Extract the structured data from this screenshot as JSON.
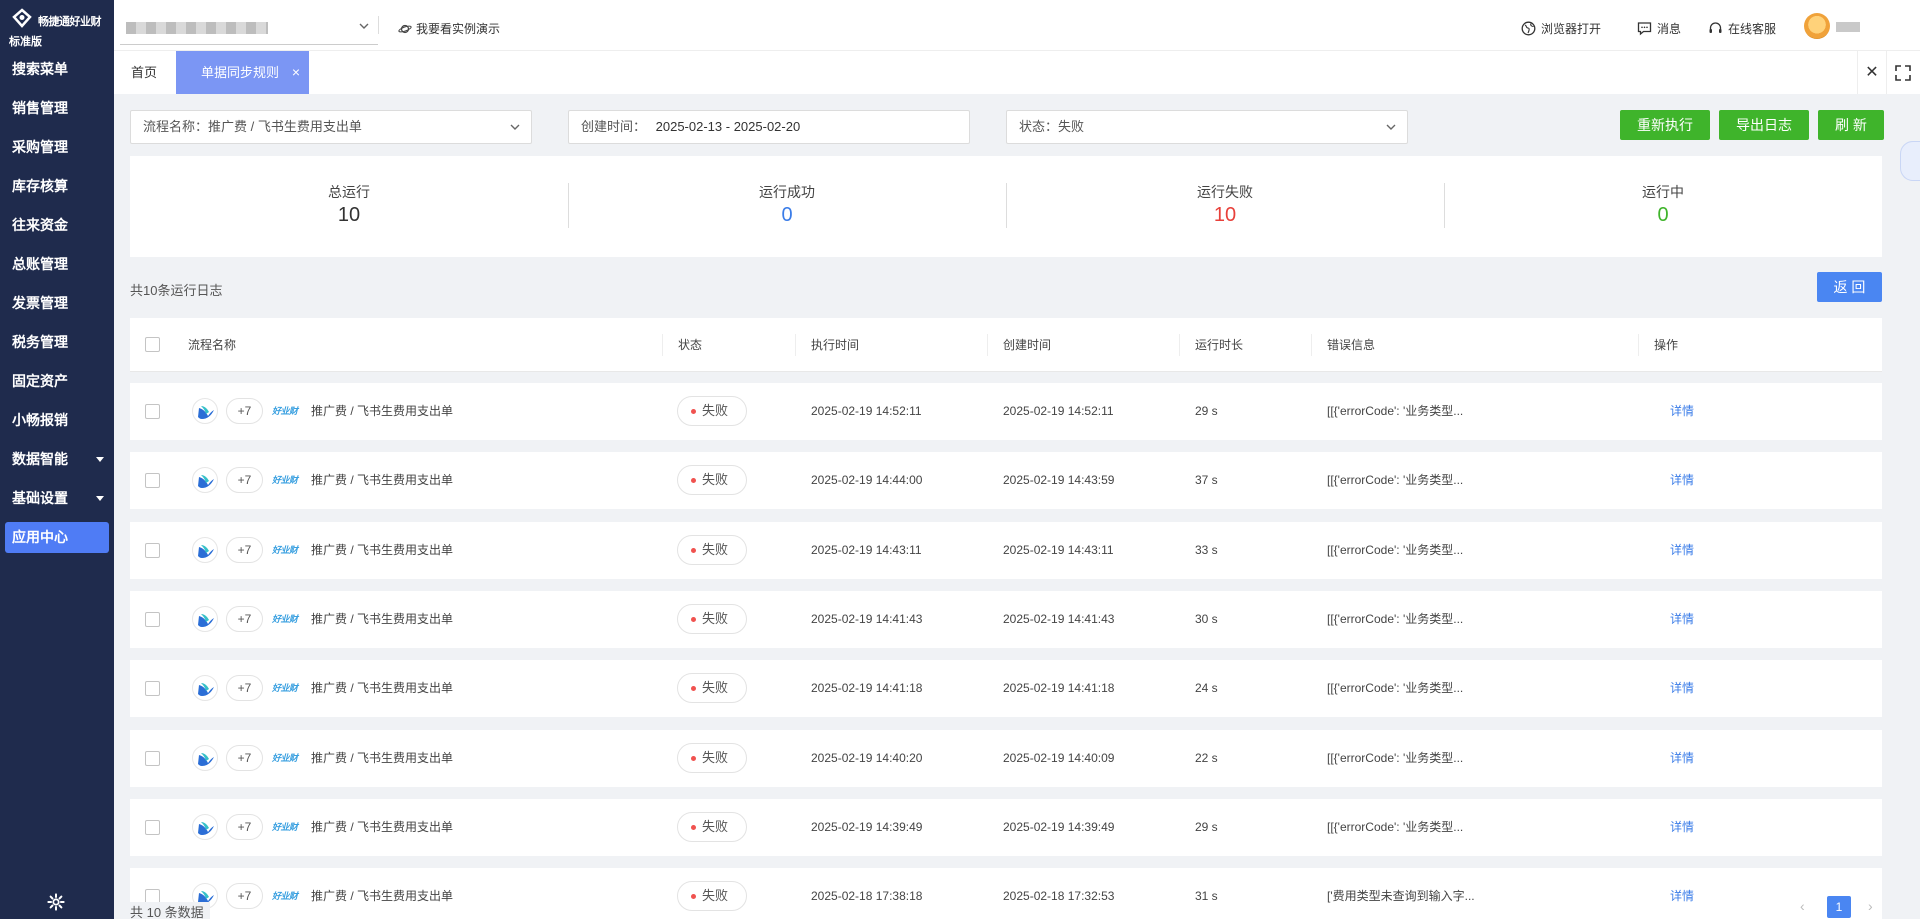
{
  "sidebar": {
    "brand": "畅捷通好业财",
    "edition": "标准版",
    "items": [
      {
        "label": "搜索菜单",
        "has_caret": false,
        "active": false
      },
      {
        "label": "销售管理",
        "has_caret": false,
        "active": false
      },
      {
        "label": "采购管理",
        "has_caret": false,
        "active": false
      },
      {
        "label": "库存核算",
        "has_caret": false,
        "active": false
      },
      {
        "label": "往来资金",
        "has_caret": false,
        "active": false
      },
      {
        "label": "总账管理",
        "has_caret": false,
        "active": false
      },
      {
        "label": "发票管理",
        "has_caret": false,
        "active": false
      },
      {
        "label": "税务管理",
        "has_caret": false,
        "active": false
      },
      {
        "label": "固定资产",
        "has_caret": false,
        "active": false
      },
      {
        "label": "小畅报销",
        "has_caret": false,
        "active": false
      },
      {
        "label": "数据智能",
        "has_caret": true,
        "active": false
      },
      {
        "label": "基础设置",
        "has_caret": true,
        "active": false
      },
      {
        "label": "应用中心",
        "has_caret": false,
        "active": true
      }
    ],
    "bg_color": "#1f2b4d",
    "active_color": "#4f7cf5"
  },
  "topbar": {
    "demo_label": "我要看实例演示",
    "browser_open": "浏览器打开",
    "messages": "消息",
    "support": "在线客服"
  },
  "tabs": {
    "home": "首页",
    "active": "单据同步规则",
    "close_symbol": "×",
    "close_all_symbol": "✕"
  },
  "filters": {
    "flow": "流程名称：推广费 / 飞书生费用支出单",
    "created_label": "创建时间：",
    "created_range": "2025-02-13 - 2025-02-20",
    "status": "状态：失败"
  },
  "buttons": {
    "rerun": "重新执行",
    "export_log": "导出日志",
    "refresh": "刷 新",
    "back": "返 回"
  },
  "stats": [
    {
      "label": "总运行",
      "value": "10",
      "color": "#333333"
    },
    {
      "label": "运行成功",
      "value": "0",
      "color": "#3a7ce8"
    },
    {
      "label": "运行失败",
      "value": "10",
      "color": "#e8403a"
    },
    {
      "label": "运行中",
      "value": "0",
      "color": "#3fb42b"
    }
  ],
  "log_count": "共10条运行日志",
  "table": {
    "headers": {
      "flow_name": "流程名称",
      "status": "状态",
      "exec_time": "执行时间",
      "create_time": "创建时间",
      "duration": "运行时长",
      "error": "错误信息",
      "action": "操作"
    },
    "rows": [
      {
        "plus": "+7",
        "brand": "好业财",
        "flow": "推广费 / 飞书生费用支出单",
        "status": "失败",
        "exec_time": "2025-02-19 14:52:11",
        "create_time": "2025-02-19 14:52:11",
        "duration": "29 s",
        "error": "[[{'errorCode': '业务类型...",
        "action": "详情"
      },
      {
        "plus": "+7",
        "brand": "好业财",
        "flow": "推广费 / 飞书生费用支出单",
        "status": "失败",
        "exec_time": "2025-02-19 14:44:00",
        "create_time": "2025-02-19 14:43:59",
        "duration": "37 s",
        "error": "[[{'errorCode': '业务类型...",
        "action": "详情"
      },
      {
        "plus": "+7",
        "brand": "好业财",
        "flow": "推广费 / 飞书生费用支出单",
        "status": "失败",
        "exec_time": "2025-02-19 14:43:11",
        "create_time": "2025-02-19 14:43:11",
        "duration": "33 s",
        "error": "[[{'errorCode': '业务类型...",
        "action": "详情"
      },
      {
        "plus": "+7",
        "brand": "好业财",
        "flow": "推广费 / 飞书生费用支出单",
        "status": "失败",
        "exec_time": "2025-02-19 14:41:43",
        "create_time": "2025-02-19 14:41:43",
        "duration": "30 s",
        "error": "[[{'errorCode': '业务类型...",
        "action": "详情"
      },
      {
        "plus": "+7",
        "brand": "好业财",
        "flow": "推广费 / 飞书生费用支出单",
        "status": "失败",
        "exec_time": "2025-02-19 14:41:18",
        "create_time": "2025-02-19 14:41:18",
        "duration": "24 s",
        "error": "[[{'errorCode': '业务类型...",
        "action": "详情"
      },
      {
        "plus": "+7",
        "brand": "好业财",
        "flow": "推广费 / 飞书生费用支出单",
        "status": "失败",
        "exec_time": "2025-02-19 14:40:20",
        "create_time": "2025-02-19 14:40:09",
        "duration": "22 s",
        "error": "[[{'errorCode': '业务类型...",
        "action": "详情"
      },
      {
        "plus": "+7",
        "brand": "好业财",
        "flow": "推广费 / 飞书生费用支出单",
        "status": "失败",
        "exec_time": "2025-02-19 14:39:49",
        "create_time": "2025-02-19 14:39:49",
        "duration": "29 s",
        "error": "[[{'errorCode': '业务类型...",
        "action": "详情"
      },
      {
        "plus": "+7",
        "brand": "好业财",
        "flow": "推广费 / 飞书生费用支出单",
        "status": "失败",
        "exec_time": "2025-02-18 17:38:18",
        "create_time": "2025-02-18 17:32:53",
        "duration": "31 s",
        "error": "['费用类型未查询到输入字...",
        "action": "详情"
      }
    ]
  },
  "footer": {
    "total": "共 10 条数据",
    "current_page": "1",
    "prev": "‹",
    "next": "›"
  }
}
